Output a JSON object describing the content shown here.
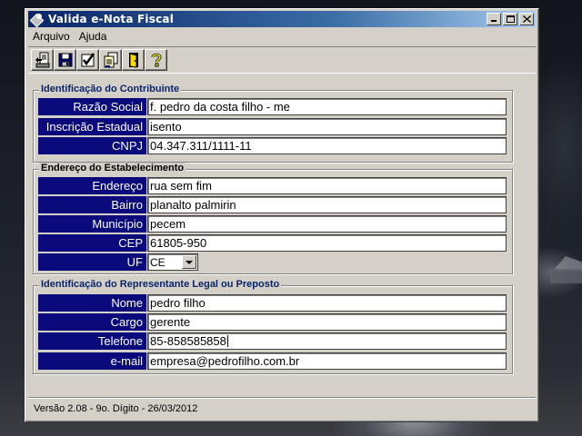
{
  "window": {
    "title": "Valida e-Nota Fiscal"
  },
  "menu": [
    {
      "label": "Arquivo"
    },
    {
      "label": "Ajuda"
    }
  ],
  "toolbar": [
    {
      "icon": "open-file-icon"
    },
    {
      "icon": "save-disk-icon"
    },
    {
      "icon": "validate-check-icon"
    },
    {
      "icon": "copy-documents-icon"
    },
    {
      "icon": "exit-door-icon"
    },
    {
      "icon": "help-question-icon"
    }
  ],
  "contribuinte": {
    "title": "Identificação do Contribuinte",
    "razao_social": {
      "label": "Razão Social",
      "value": "f. pedro da costa filho - me"
    },
    "inscricao_estadual": {
      "label": "Inscrição Estadual",
      "value": "isento"
    },
    "cnpj": {
      "label": "CNPJ",
      "value": "04.347.311/1111-11"
    }
  },
  "endereco": {
    "title": "Endereço do Estabelecimento",
    "endereco": {
      "label": "Endereço",
      "value": "rua sem fim"
    },
    "bairro": {
      "label": "Bairro",
      "value": "planalto palmirin"
    },
    "municipio": {
      "label": "Município",
      "value": "pecem"
    },
    "cep": {
      "label": "CEP",
      "value": "61805-950"
    },
    "uf": {
      "label": "UF",
      "value": "CE"
    }
  },
  "representante": {
    "title": "Identificação do Representante Legal ou Preposto",
    "nome": {
      "label": "Nome",
      "value": "pedro filho"
    },
    "cargo": {
      "label": "Cargo",
      "value": "gerente"
    },
    "telefone": {
      "label": "Telefone",
      "value": "85-858585858"
    },
    "email": {
      "label": "e-mail",
      "value": "empresa@pedrofilho.com.br"
    }
  },
  "status": {
    "text": "Versão 2.08 - 9o. Dígito - 26/03/2012"
  },
  "colors": {
    "title_start": "#0a246a",
    "title_end": "#a6caf0",
    "label_bg": "#0a0a7c",
    "face": "#d4d0c8"
  }
}
